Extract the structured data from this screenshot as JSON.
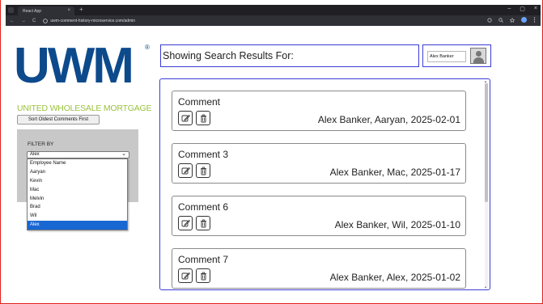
{
  "browser": {
    "tab_title": "React App",
    "url": "uwm-comment-history-microservice.com/admin",
    "new_tab_glyph": "+",
    "close_glyph": "×",
    "nav_icons": [
      "←",
      "→",
      "C"
    ],
    "window_controls": [
      "–",
      "▢",
      "×"
    ]
  },
  "logo": {
    "text": "UWM",
    "registered": "®",
    "subtitle": "UNITED WHOLESALE MORTGAGE",
    "brand_color": "#0d4a8c",
    "accent_color": "#9bc23c"
  },
  "sort_button_label": "Sort Oldest Comments First",
  "filter": {
    "label": "FILTER BY",
    "selected": "Alex",
    "options": [
      "Employee Name",
      "Aaryan",
      "Kevin",
      "Mac",
      "Melvin",
      "Brad",
      "Wil",
      "Alex"
    ]
  },
  "search": {
    "heading": "Showing Search Results For:"
  },
  "user": {
    "name": "Alex Banker"
  },
  "comments": [
    {
      "title": "Comment",
      "meta": "Alex Banker, Aaryan, 2025-02-01"
    },
    {
      "title": "Comment 3",
      "meta": "Alex Banker, Mac, 2025-01-17"
    },
    {
      "title": "Comment 6",
      "meta": "Alex Banker, Wil, 2025-01-10"
    },
    {
      "title": "Comment 7",
      "meta": "Alex Banker, Alex, 2025-01-02"
    }
  ],
  "icons": {
    "edit": "edit-icon",
    "delete": "trash-icon"
  },
  "colors": {
    "frame_border": "#e0221c",
    "box_border": "#3b3bd6",
    "selected_option": "#1967d2"
  }
}
